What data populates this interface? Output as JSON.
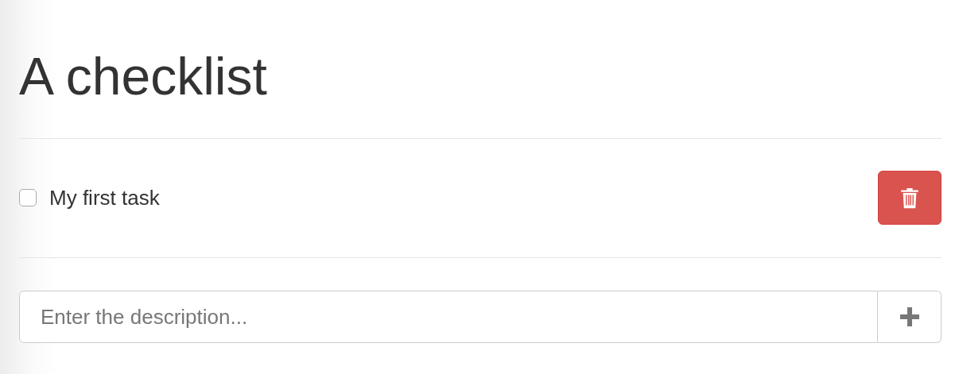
{
  "title": "A checklist",
  "tasks": [
    {
      "label": "My first task",
      "checked": false
    }
  ],
  "new_task": {
    "placeholder": "Enter the description..."
  }
}
